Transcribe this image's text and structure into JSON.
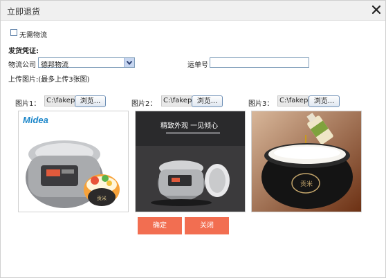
{
  "dialog": {
    "title": "立即退货"
  },
  "no_logistics": {
    "label": "无需物流",
    "checked": false
  },
  "shipping_proof_label": "发货凭证:",
  "logistics": {
    "label": "物流公司",
    "selected": "德邦物流"
  },
  "tracking": {
    "label": "运单号",
    "value": ""
  },
  "upload": {
    "label": "上传图片:(最多上传3张图)"
  },
  "images": [
    {
      "label": "图片1：",
      "file_value": "C:\\fakepath\\",
      "browse_label": "浏览..."
    },
    {
      "label": "图片2：",
      "file_value": "C:\\fakepath\\",
      "browse_label": "浏览..."
    },
    {
      "label": "图片3：",
      "file_value": "C:\\fakepath\\",
      "browse_label": "浏览..."
    }
  ],
  "thumb1": {
    "brand": "Midea",
    "badge": "贡米"
  },
  "thumb2": {
    "headline": "精致外观 一见倾心"
  },
  "thumb3": {
    "badge": "贡米"
  },
  "buttons": {
    "confirm": "确定",
    "close": "关闭"
  },
  "colors": {
    "primary_button": "#f26e51",
    "titlebar": "#f0f0f0"
  },
  "icons": {
    "close": "close-icon",
    "dropdown": "chevron-down-icon"
  }
}
